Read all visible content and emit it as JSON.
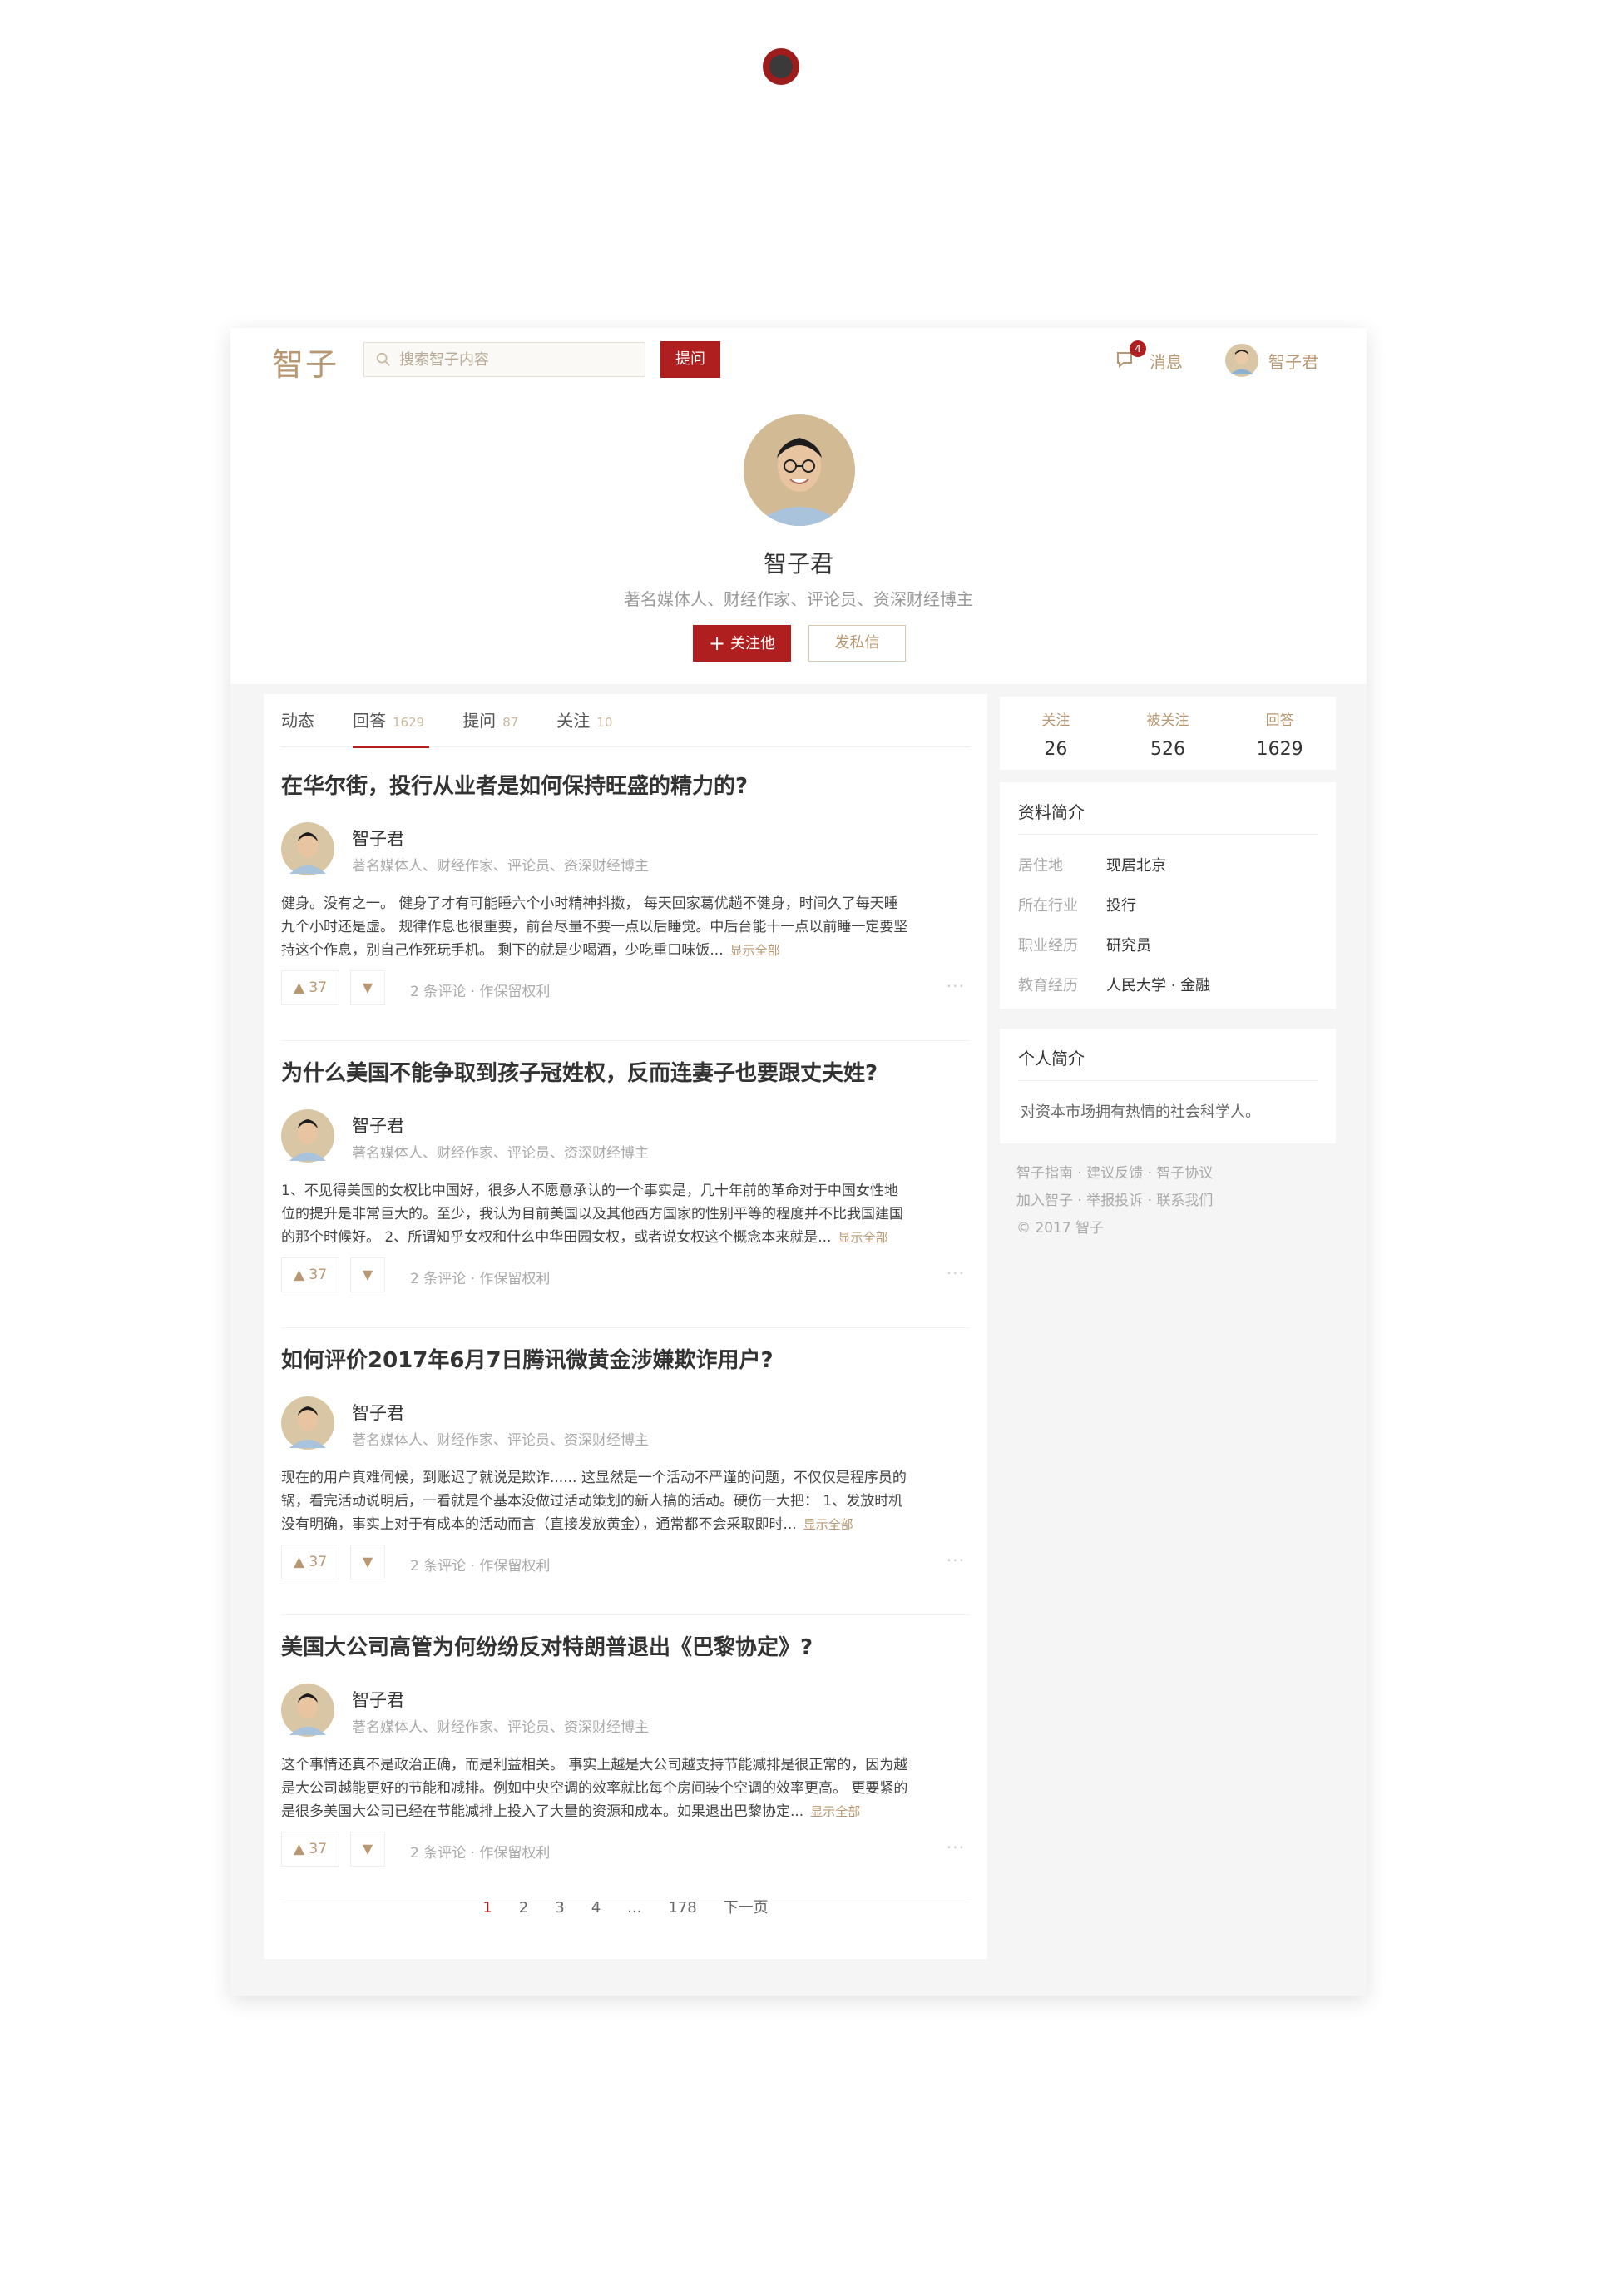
{
  "header": {
    "logo": "智子",
    "search_placeholder": "搜索智子内容",
    "ask_label": "提问",
    "messages_label": "消息",
    "messages_count": "4",
    "user_name": "智子君"
  },
  "profile": {
    "name": "智子君",
    "bio": "著名媒体人、财经作家、评论员、资深财经博主",
    "follow_label": "关注他",
    "message_label": "发私信"
  },
  "tabs": [
    {
      "label": "动态",
      "count": ""
    },
    {
      "label": "回答",
      "count": "1629"
    },
    {
      "label": "提问",
      "count": "87"
    },
    {
      "label": "关注",
      "count": "10"
    }
  ],
  "answers": [
    {
      "question": "在华尔街，投行从业者是如何保持旺盛的精力的?",
      "author": "智子君",
      "author_bio": "著名媒体人、财经作家、评论员、资深财经博主",
      "excerpt_lines": [
        "健身。没有之一。 健身了才有可能睡六个小时精神抖擞， 每天回家葛优趟不健身，时间久了每天睡",
        "九个小时还是虚。 规律作息也很重要，前台尽量不要一点以后睡觉。中后台能十一点以前睡一定要坚",
        "持这个作息，别自己作死玩手机。 剩下的就是少喝酒，少吃重口味饭..."
      ],
      "more": "显示全部",
      "votes": "37",
      "meta": "2 条评论 · 作保留权利"
    },
    {
      "question": "为什么美国不能争取到孩子冠姓权，反而连妻子也要跟丈夫姓?",
      "author": "智子君",
      "author_bio": "著名媒体人、财经作家、评论员、资深财经博主",
      "excerpt_lines": [
        "1、不见得美国的女权比中国好，很多人不愿意承认的一个事实是，几十年前的革命对于中国女性地",
        "位的提升是非常巨大的。至少，我认为目前美国以及其他西方国家的性别平等的程度并不比我国建国",
        "的那个时候好。 2、所谓知乎女权和什么中华田园女权，或者说女权这个概念本来就是..."
      ],
      "more": "显示全部",
      "votes": "37",
      "meta": "2 条评论 · 作保留权利"
    },
    {
      "question": "如何评价2017年6月7日腾讯微黄金涉嫌欺诈用户?",
      "author": "智子君",
      "author_bio": "著名媒体人、财经作家、评论员、资深财经博主",
      "excerpt_lines": [
        "现在的用户真难伺候，到账迟了就说是欺诈...... 这显然是一个活动不严谨的问题，不仅仅是程序员的",
        "锅，看完活动说明后，一看就是个基本没做过活动策划的新人搞的活动。硬伤一大把： 1、发放时机",
        "没有明确，事实上对于有成本的活动而言（直接发放黄金），通常都不会采取即时..."
      ],
      "more": "显示全部",
      "votes": "37",
      "meta": "2 条评论 · 作保留权利"
    },
    {
      "question": "美国大公司高管为何纷纷反对特朗普退出《巴黎协定》?",
      "author": "智子君",
      "author_bio": "著名媒体人、财经作家、评论员、资深财经博主",
      "excerpt_lines": [
        "这个事情还真不是政治正确，而是利益相关。 事实上越是大公司越支持节能减排是很正常的，因为越",
        "是大公司越能更好的节能和减排。例如中央空调的效率就比每个房间装个空调的效率更高。 更要紧的",
        "是很多美国大公司已经在节能减排上投入了大量的资源和成本。如果退出巴黎协定..."
      ],
      "more": "显示全部",
      "votes": "37",
      "meta": "2 条评论 · 作保留权利"
    }
  ],
  "pager": {
    "pages": [
      "1",
      "2",
      "3",
      "4",
      "...",
      "178"
    ],
    "next": "下一页",
    "current": "1"
  },
  "stats": [
    {
      "label": "关注",
      "value": "26"
    },
    {
      "label": "被关注",
      "value": "526"
    },
    {
      "label": "回答",
      "value": "1629"
    }
  ],
  "info_card": {
    "title": "资料简介",
    "rows": [
      {
        "key": "居住地",
        "value": "现居北京"
      },
      {
        "key": "所在行业",
        "value": "投行"
      },
      {
        "key": "职业经历",
        "value": "研究员"
      },
      {
        "key": "教育经历",
        "value": "人民大学 · 金融"
      }
    ]
  },
  "intro_card": {
    "title": "个人简介",
    "text": "对资本市场拥有热情的社会科学人。"
  },
  "footer": {
    "line1": "智子指南 · 建议反馈 · 智子协议",
    "line2": "加入智子 · 举报投诉 · 联系我们",
    "line3": "© 2017 智子"
  },
  "colors": {
    "brand_red": "#b01f1f",
    "gold": "#b89872"
  },
  "icons": {
    "search": "search-icon",
    "message": "message-icon",
    "vote_up": "triangle-up-icon",
    "vote_down": "triangle-down-icon",
    "more": "more-dots-icon"
  }
}
